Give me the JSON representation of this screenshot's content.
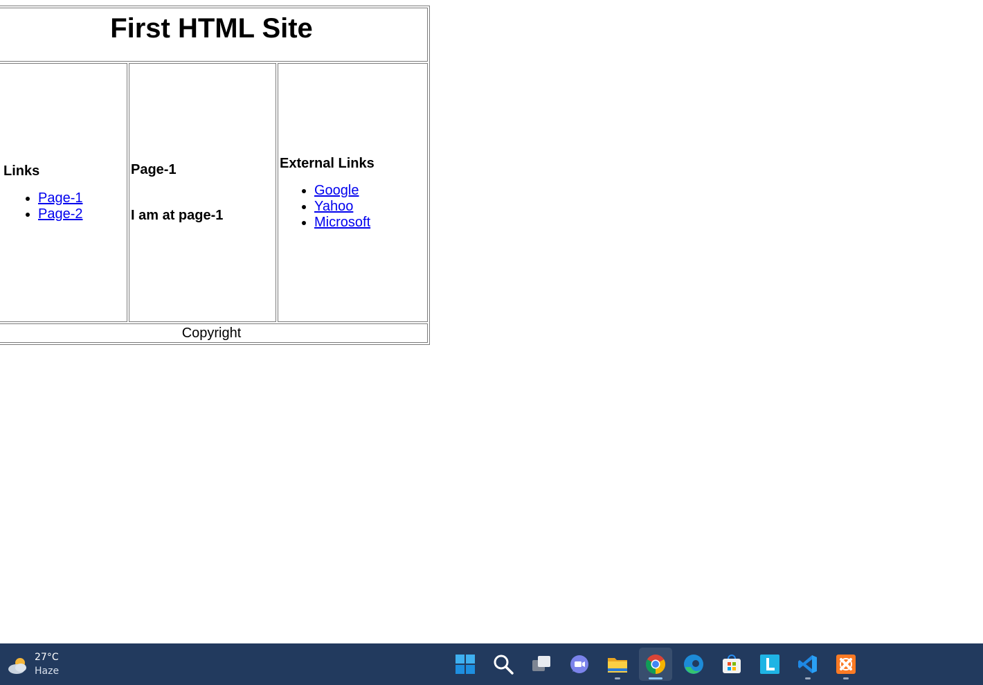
{
  "page": {
    "title": "First HTML Site",
    "left": {
      "heading": "Links",
      "links": [
        "Page-1",
        "Page-2"
      ]
    },
    "middle": {
      "heading": "Page-1",
      "text": "I am at page-1"
    },
    "right": {
      "heading": "External Links",
      "links": [
        "Google",
        "Yahoo",
        "Microsoft"
      ]
    },
    "footer": "Copyright"
  },
  "taskbar": {
    "weather": {
      "temp": "27°C",
      "condition": "Haze",
      "icon": "partly-cloudy-icon"
    },
    "apps": [
      {
        "name": "start",
        "icon": "windows-start-icon",
        "active": false,
        "running": false
      },
      {
        "name": "search",
        "icon": "search-icon",
        "active": false,
        "running": false
      },
      {
        "name": "task-view",
        "icon": "task-view-icon",
        "active": false,
        "running": false
      },
      {
        "name": "teams-chat",
        "icon": "chat-icon",
        "active": false,
        "running": false
      },
      {
        "name": "file-explorer",
        "icon": "folder-icon",
        "active": false,
        "running": true
      },
      {
        "name": "chrome",
        "icon": "chrome-icon",
        "active": true,
        "running": true
      },
      {
        "name": "edge",
        "icon": "edge-icon",
        "active": false,
        "running": false
      },
      {
        "name": "store",
        "icon": "store-icon",
        "active": false,
        "running": false
      },
      {
        "name": "l-app",
        "icon": "l-app-icon",
        "active": false,
        "running": false
      },
      {
        "name": "vscode",
        "icon": "vscode-icon",
        "active": false,
        "running": true
      },
      {
        "name": "xampp",
        "icon": "xampp-icon",
        "active": false,
        "running": true
      }
    ],
    "colors": {
      "background": "#223a5e",
      "link": "#0000ee"
    }
  }
}
